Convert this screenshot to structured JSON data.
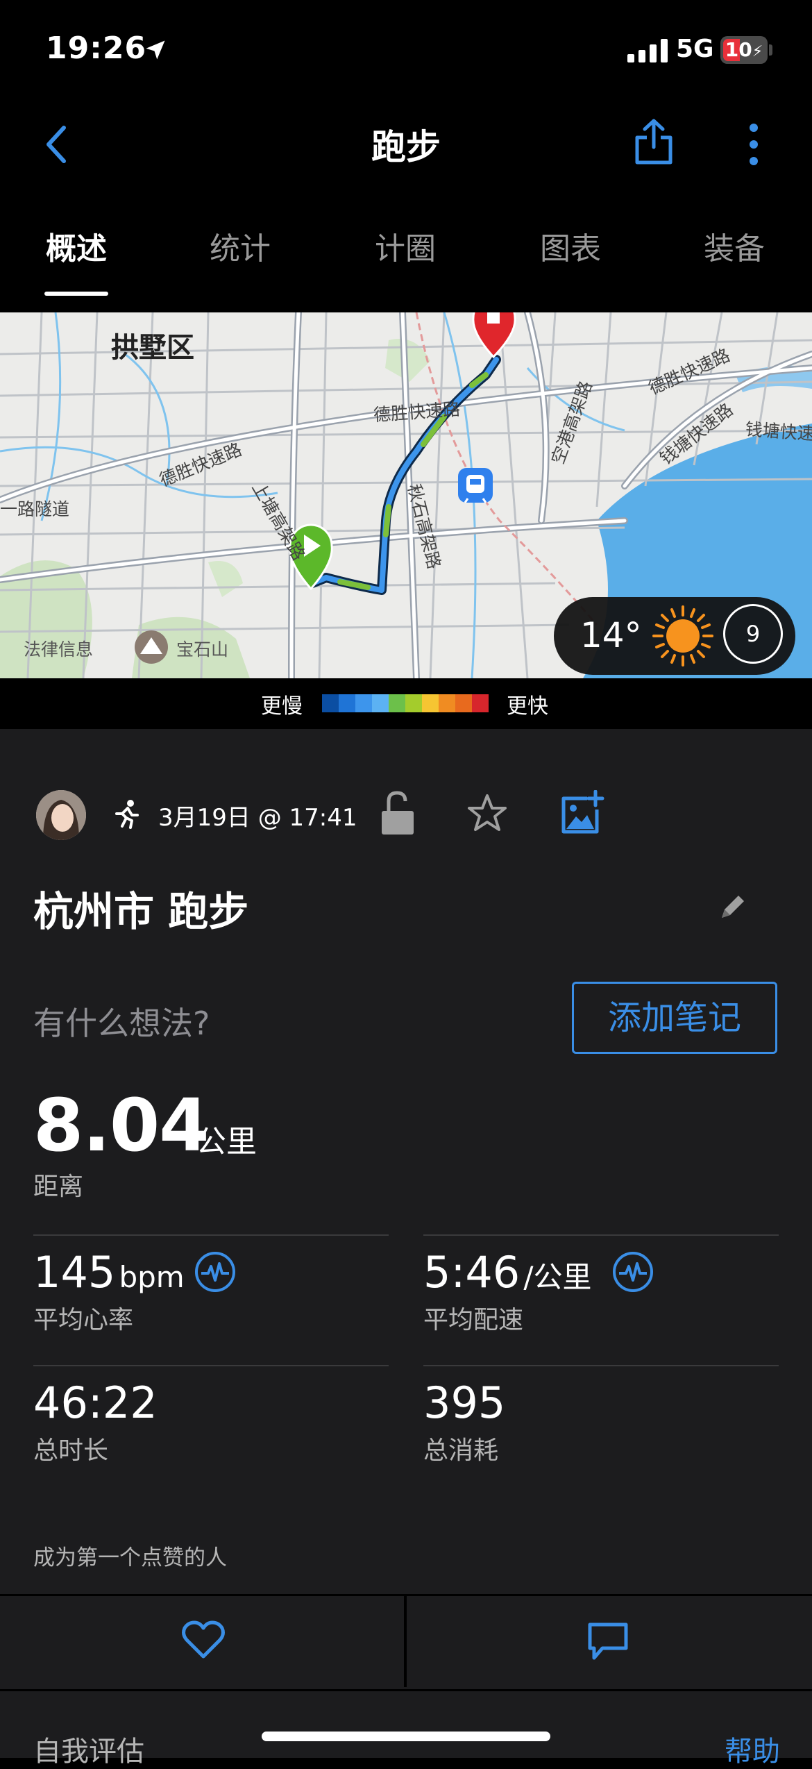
{
  "status_bar": {
    "time": "19:26",
    "network": "5G",
    "battery": "10",
    "icons": [
      "location-arrow-icon",
      "signal-icon",
      "battery-icon"
    ]
  },
  "nav": {
    "title": "跑步",
    "icons": [
      "back-icon",
      "share-icon",
      "more-icon"
    ]
  },
  "tabs": [
    "概述",
    "统计",
    "计圈",
    "图表",
    "装备"
  ],
  "active_tab": 0,
  "map": {
    "labels": [
      "拱墅区",
      "德胜快速路",
      "德胜快速路",
      "德胜快速路",
      "钱塘快速路",
      "钱塘快速",
      "一路隧道",
      "上塘高架路",
      "秋石高架路",
      "空港高架路",
      "法律信息",
      "宝石山"
    ],
    "weather": {
      "temperature": "14°",
      "wind": "9"
    }
  },
  "pace_legend": {
    "slower": "更慢",
    "faster": "更快",
    "colors": [
      "#0b4ea2",
      "#1f74d6",
      "#3d95ec",
      "#5cb2f3",
      "#6cc04a",
      "#a4cc2c",
      "#f6c532",
      "#f08c22",
      "#e86a1e",
      "#d7262c"
    ]
  },
  "activity": {
    "date": "3月19日 @ 17:41",
    "title": "杭州市 跑步",
    "note_prompt": "有什么想法?",
    "add_note_label": "添加笔记",
    "distance": {
      "value": "8.04",
      "unit": "公里",
      "label": "距离"
    },
    "stats": [
      {
        "value": "145",
        "unit": "bpm",
        "label": "平均心率"
      },
      {
        "value": "5:46",
        "unit": "/公里",
        "label": "平均配速"
      },
      {
        "value": "46:22",
        "unit": "",
        "label": "总时长"
      },
      {
        "value": "395",
        "unit": "",
        "label": "总消耗"
      }
    ],
    "kudos_text": "成为第一个点赞的人"
  },
  "footer": {
    "self_eval": "自我评估",
    "help": "帮助"
  },
  "colors": {
    "accent_blue": "#3a8ee6",
    "background": "#1c1c1e",
    "start_marker": "#5cb82a",
    "end_marker": "#e0262c"
  }
}
